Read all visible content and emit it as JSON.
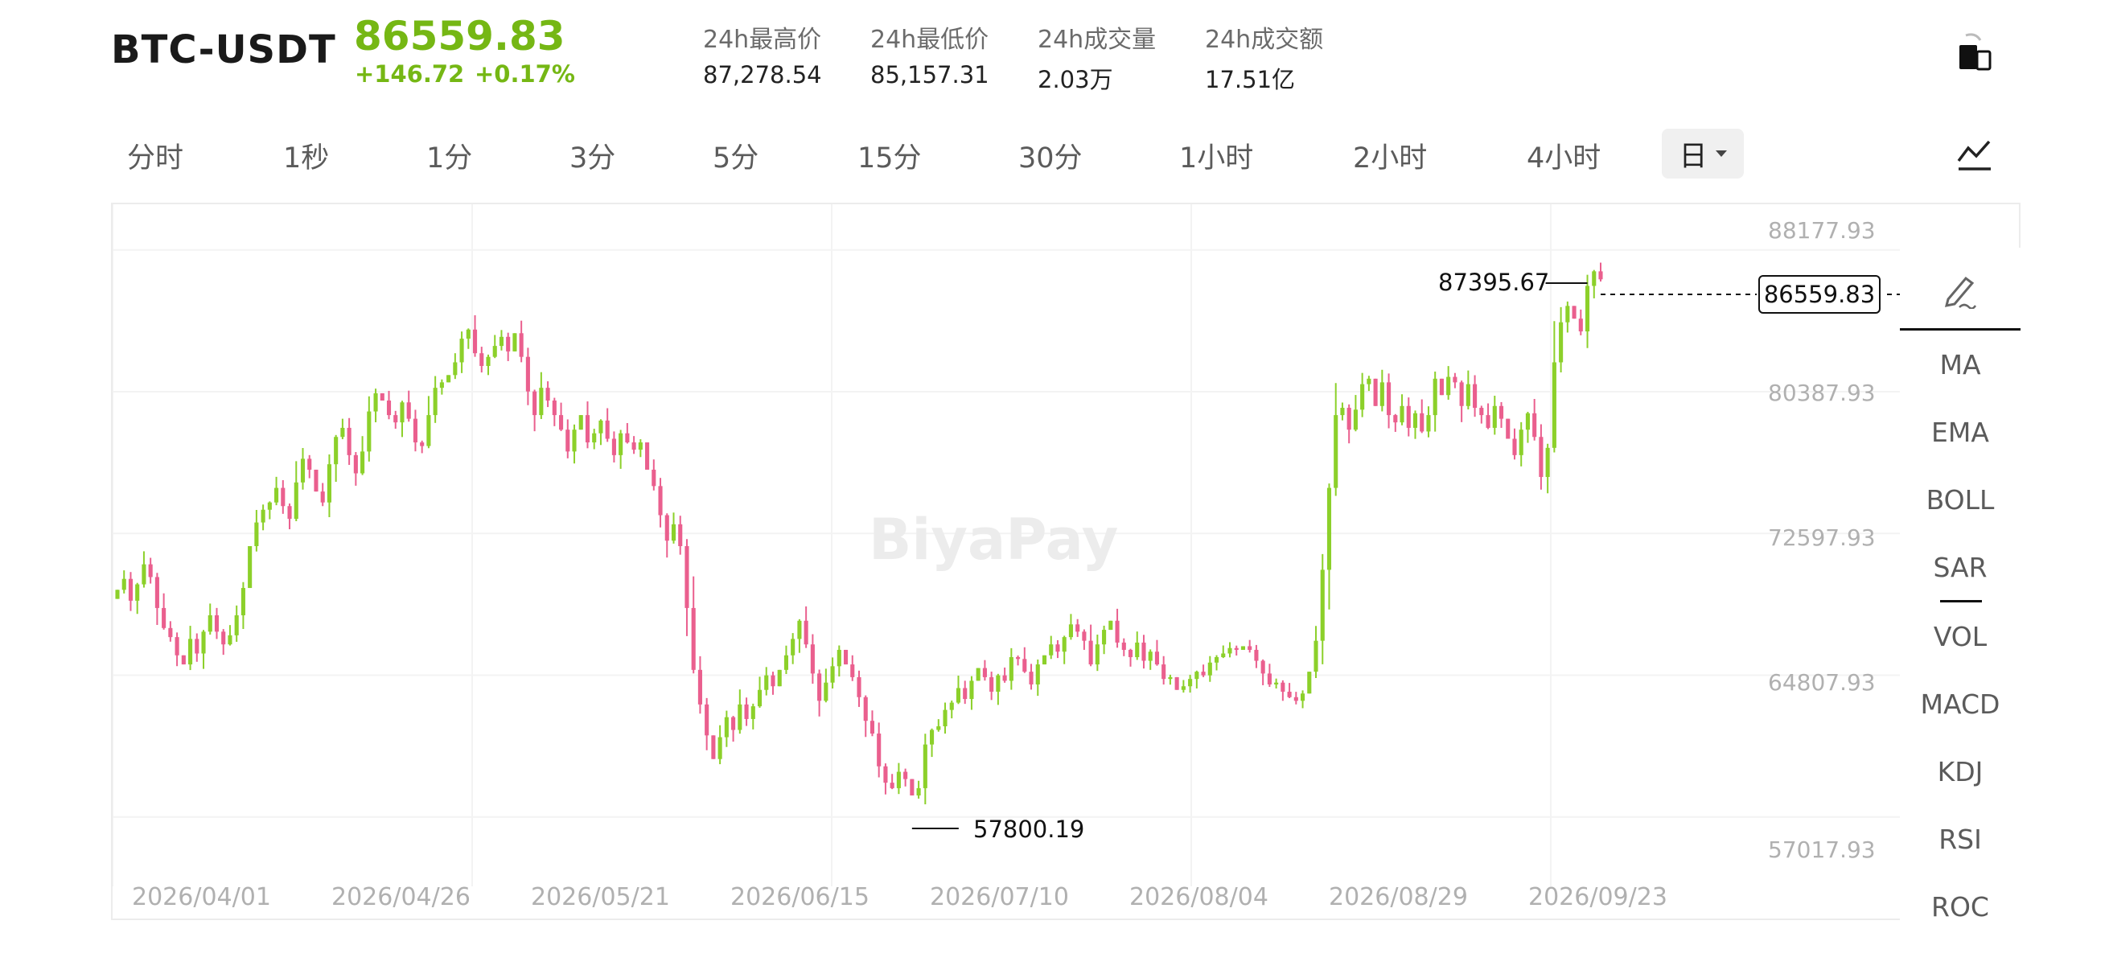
{
  "header": {
    "pair": "BTC-USDT",
    "last_price": "86559.83",
    "change": "+146.72",
    "change_pct": "+0.17%",
    "stats": [
      {
        "label": "24h最高价",
        "value": "87,278.54"
      },
      {
        "label": "24h最低价",
        "value": "85,157.31"
      },
      {
        "label": "24h成交量",
        "value": "2.03万"
      },
      {
        "label": "24h成交额",
        "value": "17.51亿"
      }
    ],
    "switch_icon": "landscape-toggle-icon"
  },
  "timeframes": [
    "分时",
    "1秒",
    "1分",
    "3分",
    "5分",
    "15分",
    "30分",
    "1小时",
    "2小时",
    "4小时"
  ],
  "selected_timeframe": "日",
  "chart_type_icon": "line-chart-icon",
  "indicators": {
    "draw_icon": "pencil-icon",
    "main": [
      "MA",
      "EMA",
      "BOLL",
      "SAR"
    ],
    "sub": [
      "VOL",
      "MACD",
      "KDJ",
      "RSI",
      "ROC"
    ]
  },
  "watermark": "BiyaPay",
  "colors": {
    "up": "#8cd02a",
    "down": "#ea5f8e",
    "accent": "#75b714"
  },
  "chart_data": {
    "type": "candlestick",
    "y_ticks": [
      "88177.93",
      "80387.93",
      "72597.93",
      "64807.93",
      "57017.93"
    ],
    "ylim": [
      54000,
      89800
    ],
    "x_ticks": [
      "2026/04/01",
      "2026/04/26",
      "2026/05/21",
      "2026/06/15",
      "2026/07/10",
      "2026/08/04",
      "2026/08/29",
      "2026/09/23"
    ],
    "start_date": "2026-03-26",
    "max_label": "87395.67",
    "min_label": "57800.19",
    "last_price_label": "86559.83",
    "closes": [
      69500,
      70100,
      68900,
      69800,
      70900,
      70200,
      68500,
      67400,
      66900,
      65900,
      65400,
      66800,
      66000,
      67200,
      68100,
      67200,
      66500,
      67000,
      68100,
      69600,
      71900,
      73200,
      73900,
      74300,
      75100,
      74100,
      73400,
      75400,
      76700,
      76100,
      74900,
      74300,
      76400,
      77900,
      78400,
      76900,
      75900,
      77100,
      79300,
      80300,
      79900,
      79100,
      78700,
      79800,
      78900,
      77600,
      77400,
      79100,
      80600,
      80900,
      81300,
      82000,
      83300,
      83800,
      82500,
      81800,
      82300,
      82900,
      83400,
      82600,
      83600,
      82300,
      80400,
      79100,
      80600,
      79900,
      79100,
      78300,
      77100,
      78300,
      79100,
      77600,
      78100,
      78800,
      77800,
      76900,
      78100,
      77600,
      77200,
      77600,
      76100,
      75200,
      73600,
      72200,
      73100,
      71900,
      68500,
      65100,
      63200,
      61500,
      60200,
      61400,
      62500,
      61800,
      63200,
      62400,
      63100,
      64000,
      64800,
      64200,
      65100,
      65900,
      66800,
      67800,
      66500,
      64900,
      63400,
      64400,
      65300,
      66200,
      65400,
      64700,
      63600,
      62300,
      61600,
      59800,
      58900,
      58600,
      59500,
      59100,
      58200,
      58600,
      61000,
      61800,
      62000,
      62900,
      63300,
      64100,
      63500,
      64500,
      65200,
      64700,
      63900,
      64800,
      64500,
      65800,
      65700,
      65000,
      64300,
      65400,
      65900,
      66500,
      66100,
      66900,
      67600,
      67200,
      66700,
      65400,
      66500,
      67300,
      67800,
      66600,
      66200,
      65800,
      66600,
      65600,
      66100,
      65400,
      64600,
      64700,
      64000,
      64200,
      64600,
      65000,
      64800,
      65500,
      65800,
      66000,
      66300,
      66200,
      66400,
      66200,
      65600,
      64900,
      64300,
      64400,
      63900,
      63600,
      63400,
      63800,
      65000,
      66700,
      70600,
      75100,
      79100,
      79500,
      78300,
      79400,
      80800,
      81100,
      79600,
      80900,
      79100,
      78700,
      79600,
      78400,
      79200,
      78200,
      79100,
      81100,
      80200,
      81200,
      80900,
      79600,
      80800,
      79500,
      79100,
      78400,
      79600,
      78900,
      77800,
      76900,
      78300,
      79200,
      77900,
      75700,
      77300,
      82000,
      84200,
      85100,
      84400,
      83700,
      86200,
      87000,
      86560
    ],
    "opens": [
      69000,
      69500,
      70100,
      68900,
      69800,
      70900,
      70200,
      68500,
      67400,
      66900,
      65900,
      65400,
      66800,
      66000,
      67200,
      68100,
      67200,
      66500,
      67000,
      68100,
      69600,
      71900,
      73200,
      73900,
      74300,
      75100,
      74100,
      73400,
      75400,
      76700,
      76100,
      74900,
      74300,
      76400,
      77900,
      78400,
      76900,
      75900,
      77100,
      79300,
      80300,
      79900,
      79100,
      78700,
      79800,
      78900,
      77600,
      77400,
      79100,
      80600,
      80900,
      81300,
      82000,
      83300,
      83800,
      82500,
      81800,
      82300,
      82900,
      83400,
      82600,
      83600,
      82300,
      80400,
      79100,
      80600,
      79900,
      79100,
      78300,
      77100,
      78300,
      79100,
      77600,
      78100,
      78800,
      77800,
      76900,
      78100,
      77600,
      77200,
      77600,
      76100,
      75200,
      73600,
      72200,
      73100,
      71900,
      68500,
      65100,
      63200,
      61500,
      60200,
      61400,
      62500,
      61800,
      63200,
      62400,
      63100,
      64000,
      64800,
      64200,
      65100,
      65900,
      66800,
      67800,
      66500,
      64900,
      63400,
      64400,
      65300,
      66200,
      65400,
      64700,
      63600,
      62300,
      61600,
      59800,
      58900,
      58600,
      59500,
      59100,
      58200,
      58600,
      61000,
      61800,
      62000,
      62900,
      63300,
      64100,
      63500,
      64500,
      65200,
      64700,
      63900,
      64800,
      64500,
      65800,
      65700,
      65000,
      64300,
      65400,
      65900,
      66500,
      66100,
      66900,
      67600,
      67200,
      66700,
      65400,
      66500,
      67300,
      67800,
      66600,
      66200,
      65800,
      66600,
      65600,
      66100,
      65400,
      64600,
      64700,
      64000,
      64200,
      64600,
      65000,
      64800,
      65500,
      65800,
      66000,
      66300,
      66200,
      66400,
      66200,
      65600,
      64900,
      64300,
      64400,
      63900,
      63600,
      63400,
      63800,
      65000,
      66700,
      70600,
      75100,
      79100,
      79500,
      78300,
      79400,
      80800,
      81100,
      79600,
      80900,
      79100,
      78700,
      79600,
      78400,
      79200,
      78200,
      79100,
      81100,
      80200,
      81200,
      80900,
      79600,
      80800,
      79500,
      79100,
      78400,
      79600,
      78900,
      77800,
      76900,
      78300,
      79200,
      77900,
      75700,
      77300,
      82000,
      84200,
      85100,
      84400,
      83700,
      86200,
      87000
    ]
  }
}
